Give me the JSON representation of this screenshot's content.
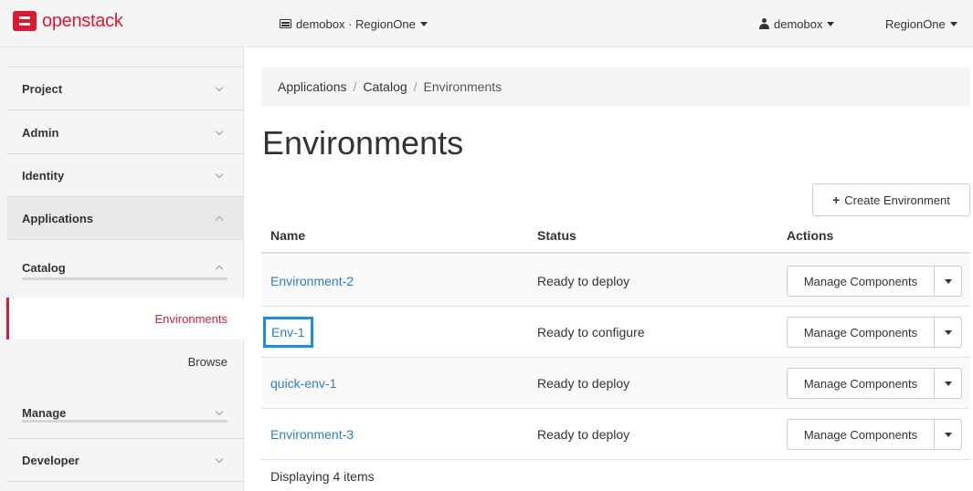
{
  "brand": {
    "logo_text_a": "open",
    "logo_text_b": "stack"
  },
  "navbar": {
    "project": "demobox · RegionOne",
    "user": "demobox",
    "region": "RegionOne"
  },
  "sidebar": {
    "items": [
      {
        "label": "Project"
      },
      {
        "label": "Admin"
      },
      {
        "label": "Identity"
      },
      {
        "label": "Applications"
      },
      {
        "label": "Catalog"
      },
      {
        "label": "Environments"
      },
      {
        "label": "Browse"
      },
      {
        "label": "Manage"
      },
      {
        "label": "Developer"
      }
    ]
  },
  "breadcrumb": {
    "crumb1": "Applications",
    "crumb2": "Catalog",
    "current": "Environments",
    "separator": "/"
  },
  "page": {
    "title": "Environments",
    "create_button": "Create Environment"
  },
  "table": {
    "headers": {
      "name": "Name",
      "status": "Status",
      "actions": "Actions"
    },
    "rows": [
      {
        "name": "Environment-2",
        "status": "Ready to deploy",
        "action": "Manage Components"
      },
      {
        "name": "Env-1",
        "status": "Ready to configure",
        "action": "Manage Components"
      },
      {
        "name": "quick-env-1",
        "status": "Ready to deploy",
        "action": "Manage Components"
      },
      {
        "name": "Environment-3",
        "status": "Ready to deploy",
        "action": "Manage Components"
      }
    ],
    "footer": "Displaying 4 items"
  },
  "colors": {
    "brand_red": "#da1a32",
    "link_blue": "#2a7fc1",
    "highlight_blue": "#1a8ee0"
  },
  "icons": {
    "logo": "openstack-logo-icon",
    "project": "project-box-icon",
    "user": "user-icon",
    "caret": "caret-down-icon",
    "chevron": "chevron-icon",
    "plus": "plus-icon"
  }
}
